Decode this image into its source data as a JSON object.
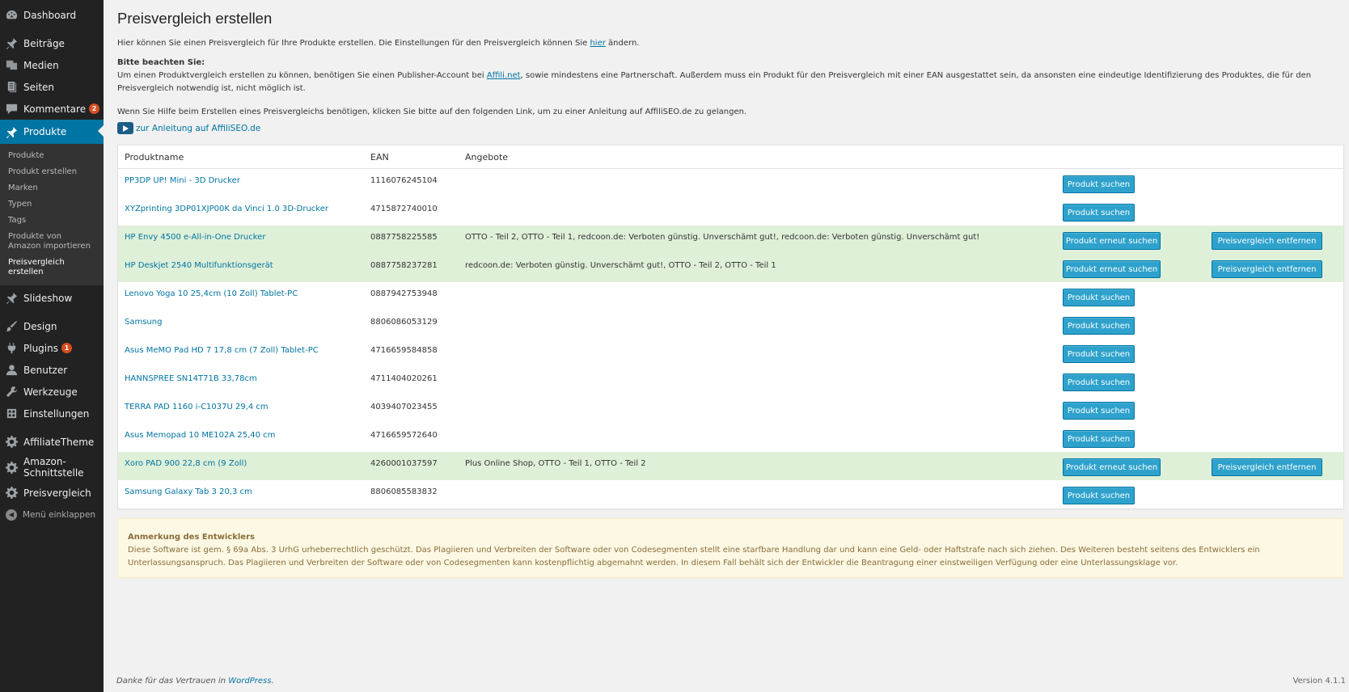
{
  "sidebar": {
    "dashboard": "Dashboard",
    "beitraege": "Beiträge",
    "medien": "Medien",
    "seiten": "Seiten",
    "kommentare": "Kommentare",
    "kommentare_badge": "2",
    "produkte": "Produkte",
    "submenu": [
      "Produkte",
      "Produkt erstellen",
      "Marken",
      "Typen",
      "Tags",
      "Produkte von Amazon importieren",
      "Preisvergleich erstellen"
    ],
    "slideshow": "Slideshow",
    "design": "Design",
    "plugins": "Plugins",
    "plugins_badge": "1",
    "benutzer": "Benutzer",
    "werkzeuge": "Werkzeuge",
    "einstellungen": "Einstellungen",
    "affiliatetheme": "AffiliateTheme",
    "amazon": "Amazon-Schnittstelle",
    "preisvergleich": "Preisvergleich",
    "collapse": "Menü einklappen"
  },
  "page": {
    "title": "Preisvergleich erstellen",
    "intro_a": "Hier können Sie einen Preisvergleich für Ihre Produkte erstellen. Die Einstellungen für den Preisvergleich können Sie ",
    "intro_link": "hier",
    "intro_b": " ändern.",
    "note_title": "Bitte beachten Sie:",
    "note_a": "Um einen Produktvergleich erstellen zu können, benötigen Sie einen Publisher-Account bei ",
    "note_link": "Affili.net",
    "note_b": ", sowie mindestens eine Partnerschaft. Außerdem muss ein Produkt für den Preisvergleich mit einer EAN ausgestattet sein, da ansonsten eine eindeutige Identifizierung des Produktes, die für den Preisvergleich notwendig ist, nicht möglich ist.",
    "help": "Wenn Sie Hilfe beim Erstellen eines Preisvergleichs benötigen, klicken Sie bitte auf den folgenden Link, um zu einer Anleitung auf AffiliSEO.de zu gelangen.",
    "tutorial_link": "zur Anleitung auf AffiliSEO.de"
  },
  "table": {
    "headers": [
      "Produktname",
      "EAN",
      "Angebote"
    ],
    "btn_search": "Produkt suchen",
    "btn_research": "Produkt erneut suchen",
    "btn_remove": "Preisvergleich entfernen",
    "rows": [
      {
        "name": "PP3DP UP! Mini - 3D Drucker",
        "ean": "1116076245104",
        "offers": "",
        "matched": false
      },
      {
        "name": "XYZprinting 3DP01XJP00K da Vinci 1.0 3D-Drucker",
        "ean": "4715872740010",
        "offers": "",
        "matched": false
      },
      {
        "name": "HP Envy 4500 e-All-in-One Drucker",
        "ean": "0887758225585",
        "offers": "OTTO - Teil 2, OTTO - Teil 1, redcoon.de: Verboten günstig. Unverschämt gut!, redcoon.de: Verboten günstig. Unverschämt gut!",
        "matched": true
      },
      {
        "name": "HP Deskjet 2540 Multifunktionsgerät",
        "ean": "0887758237281",
        "offers": "redcoon.de: Verboten günstig. Unverschämt gut!, OTTO - Teil 2, OTTO - Teil 1",
        "matched": true
      },
      {
        "name": "Lenovo Yoga 10 25,4cm (10 Zoll) Tablet-PC",
        "ean": "0887942753948",
        "offers": "",
        "matched": false
      },
      {
        "name": "Samsung",
        "ean": "8806086053129",
        "offers": "",
        "matched": false
      },
      {
        "name": "Asus MeMO Pad HD 7 17,8 cm (7 Zoll) Tablet-PC",
        "ean": "4716659584858",
        "offers": "",
        "matched": false
      },
      {
        "name": "HANNSPREE SN14T71B 33,78cm",
        "ean": "4711404020261",
        "offers": "",
        "matched": false
      },
      {
        "name": "TERRA PAD 1160 i-C1037U 29,4 cm",
        "ean": "4039407023455",
        "offers": "",
        "matched": false
      },
      {
        "name": "Asus Memopad 10 ME102A 25,40 cm",
        "ean": "4716659572640",
        "offers": "",
        "matched": false
      },
      {
        "name": "Xoro PAD 900 22,8 cm (9 Zoll)",
        "ean": "4260001037597",
        "offers": "Plus Online Shop, OTTO - Teil 1, OTTO - Teil 2",
        "matched": true
      },
      {
        "name": "Samsung Galaxy Tab 3 20,3 cm",
        "ean": "8806085583832",
        "offers": "",
        "matched": false
      }
    ]
  },
  "notice": {
    "title": "Anmerkung des Entwicklers",
    "text": "Diese Software ist gem. § 69a Abs. 3 UrhG urheberrechtlich geschützt. Das Plagiieren und Verbreiten der Software oder von Codesegmenten stellt eine starfbare Handlung dar und kann eine Geld- oder Haftstrafe nach sich ziehen. Des Weiteren besteht seitens des Entwicklers ein Unterlassungsanspruch. Das Plagiieren und Verbreiten der Software oder von Codesegmenten kann kostenpflichtig abgemahnt werden. In diesem Fall behält sich der Entwickler die Beantragung einer einstweiligen Verfügung oder eine Unterlassungsklage vor."
  },
  "footer": {
    "thanks": "Danke für das Vertrauen in ",
    "wp": "WordPress",
    "dot": ".",
    "version": "Version 4.1.1"
  },
  "colors": {
    "accent": "#0074a2",
    "button": "#2ea2cc",
    "row_matched": "#dff0d8",
    "notice_bg": "#fcf8e3"
  }
}
